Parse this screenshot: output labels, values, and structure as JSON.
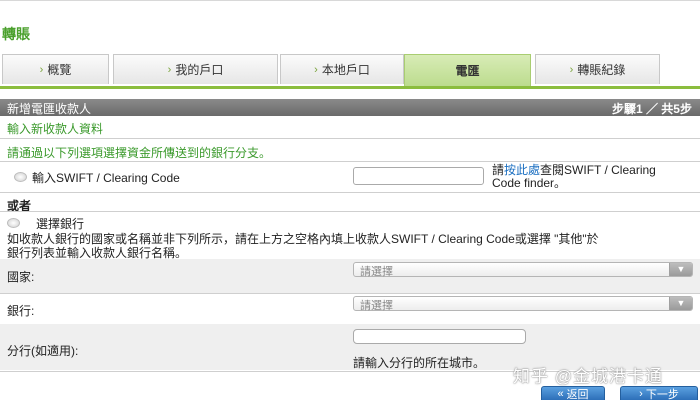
{
  "page": {
    "title": "轉賬"
  },
  "tabs": [
    {
      "label": "概覽",
      "active": false
    },
    {
      "label": "我的戶口",
      "active": false
    },
    {
      "label": "本地戶口",
      "active": false
    },
    {
      "label": "電匯",
      "active": true
    },
    {
      "label": "轉賬紀錄",
      "active": false
    }
  ],
  "step_bar": {
    "title": "新增電匯收款人",
    "step": "步驟1 ／ 共5步"
  },
  "form": {
    "section_title": "輸入新收款人資料",
    "instruction": "請通過以下列選項選擇資金所傳送到的銀行分支。",
    "option_swift": {
      "label": "輸入SWIFT / Clearing Code",
      "input_value": "",
      "help_prefix": "請",
      "help_link": "按此處",
      "help_suffix_1": "查閱SWIFT / Clearing",
      "help_suffix_2": "Code finder。"
    },
    "or_label": "或者",
    "option_bank": {
      "label": "選擇銀行",
      "description_1": "如收款人銀行的國家或名稱並非下列所示，請在上方之空格內填上收款人SWIFT / Clearing Code或選擇 \"其他\"於",
      "description_2": "銀行列表並輸入收款人銀行名稱。"
    },
    "country": {
      "label": "國家:",
      "placeholder": "請選擇"
    },
    "bank": {
      "label": "銀行:",
      "placeholder": "請選擇"
    },
    "branch": {
      "label": "分行(如適用):",
      "input_value": "",
      "hint": "請輸入分行的所在城市。"
    }
  },
  "watermark": "知乎 @金城港卡通",
  "buttons": {
    "back": "返回",
    "next": "下一步"
  },
  "icons": {
    "tab_chevron": "chevron-right-icon",
    "select_arrow": "chevron-down-icon",
    "back": "double-chevron-left-icon",
    "next": "chevron-right-icon"
  },
  "colors": {
    "accent_green": "#4aa02c",
    "tab_active": "#bcdc8e",
    "step_bar": "#7a7a7a",
    "button_blue": "#2d6fb8",
    "link_blue": "#1a6ec0"
  }
}
